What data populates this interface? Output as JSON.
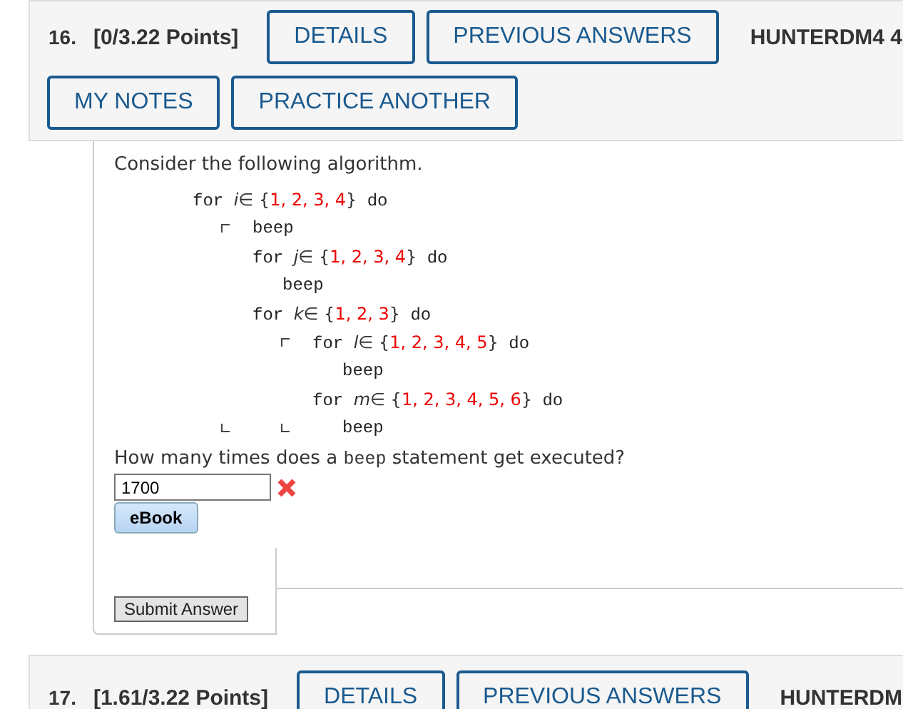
{
  "question": {
    "number": "16.",
    "points": "[0/3.22 Points]",
    "buttons": [
      "DETAILS",
      "PREVIOUS ANSWERS"
    ],
    "source": "HUNTERDM4 4",
    "buttons_row2": [
      "MY NOTES",
      "PRACTICE ANOTHER"
    ]
  },
  "intro": "Consider the following algorithm.",
  "algorithm": [
    {
      "kind": "for",
      "keyword": "for",
      "var": "i",
      "in": "∈",
      "open": "{",
      "set": "1, 2, 3, 4",
      "close": "}",
      "do": "do",
      "children": [
        {
          "kind": "beep",
          "text": "beep"
        },
        {
          "kind": "for",
          "keyword": "for",
          "var": "j",
          "in": "∈",
          "open": "{",
          "set": "1, 2, 3, 4",
          "close": "}",
          "do": "do",
          "children": [
            {
              "kind": "beep",
              "text": "beep"
            }
          ]
        },
        {
          "kind": "for",
          "keyword": "for",
          "var": "k",
          "in": "∈",
          "open": "{",
          "set": "1, 2, 3",
          "close": "}",
          "do": "do",
          "children": [
            {
              "kind": "for",
              "keyword": "for",
              "var": "l",
              "in": "∈",
              "open": "{",
              "set": "1, 2, 3, 4, 5",
              "close": "}",
              "do": "do",
              "children": [
                {
                  "kind": "beep",
                  "text": "beep"
                }
              ]
            },
            {
              "kind": "for",
              "keyword": "for",
              "var": "m",
              "in": "∈",
              "open": "{",
              "set": "1, 2, 3, 4, 5, 6",
              "close": "}",
              "do": "do",
              "children": [
                {
                  "kind": "beep",
                  "text": "beep"
                }
              ]
            }
          ]
        }
      ]
    }
  ],
  "prompt": {
    "before": "How many times does a",
    "code": "beep",
    "after": "statement get executed?"
  },
  "answer": {
    "value": "1700",
    "correct": false
  },
  "ebook": "eBook",
  "submit": "Submit Answer",
  "next_question": {
    "number": "17.",
    "points": "[1.61/3.22 Points]",
    "buttons": [
      "DETAILS",
      "PREVIOUS ANSWERS"
    ],
    "source": "HUNTERDM"
  }
}
